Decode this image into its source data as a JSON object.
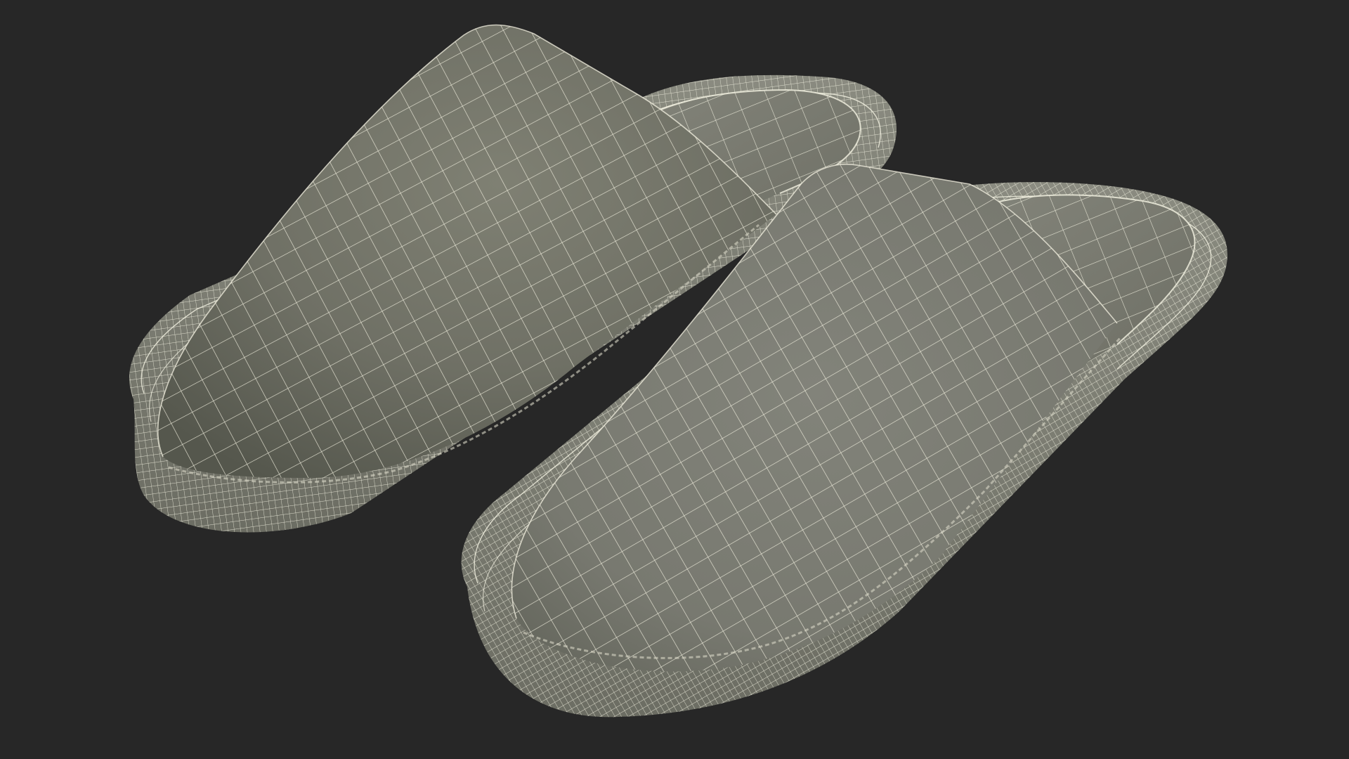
{
  "scene": {
    "background_color": "#272727",
    "surface_color": "#7d7e71",
    "surface_shadow_color": "#585a50",
    "wire_color": "#f4f2e2",
    "object": "pair-of-slippers-wireframe",
    "view_mode": "wireframe-on-shaded"
  }
}
